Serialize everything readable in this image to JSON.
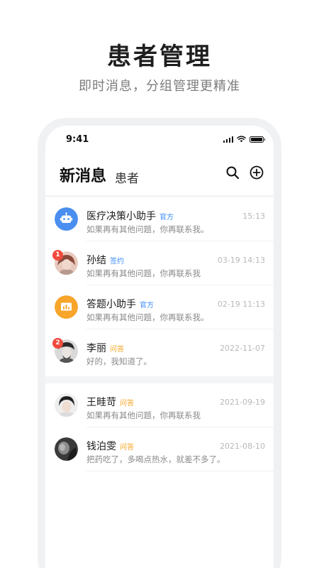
{
  "promo": {
    "title": "患者管理",
    "subtitle": "即时消息，分组管理更精准"
  },
  "status_bar": {
    "time": "9:41"
  },
  "header": {
    "title": "新消息",
    "tab": "患者",
    "search_icon": "search-icon",
    "add_icon": "plus-circle-icon"
  },
  "colors": {
    "accent_blue": "#3c8cf5",
    "accent_orange": "#f5a623",
    "badge_red": "#f04a3e"
  },
  "messages_new": [
    {
      "name": "医疗决策小助手",
      "tag": "官方",
      "tag_color": "blue",
      "preview": "如果再有其他问题，你再联系我。",
      "time": "15:13",
      "avatar": "robot-icon"
    },
    {
      "name": "孙结",
      "tag": "签约",
      "tag_color": "blue",
      "preview": "如果再有其他问题，你再联系我",
      "time": "03-19 14:13",
      "avatar": "user-photo",
      "badge": "1"
    },
    {
      "name": "答题小助手",
      "tag": "官方",
      "tag_color": "blue",
      "preview": "如果再有其他问题，你再联系我。",
      "time": "02-19 11:13",
      "avatar": "chart-icon"
    },
    {
      "name": "李丽",
      "tag": "问答",
      "tag_color": "orange",
      "preview": "好的，我知道了。",
      "time": "2022-11-07",
      "avatar": "user-photo",
      "badge": "2"
    }
  ],
  "messages_old": [
    {
      "name": "王畦苛",
      "tag": "问答",
      "tag_color": "orange",
      "preview": "如果再有其他问题，你再联系我",
      "time": "2021-09-19",
      "avatar": "user-photo"
    },
    {
      "name": "钱泊雯",
      "tag": "问答",
      "tag_color": "orange",
      "preview": "把药吃了，多喝点热水，就差不多了。",
      "time": "2021-08-10",
      "avatar": "user-photo"
    }
  ]
}
